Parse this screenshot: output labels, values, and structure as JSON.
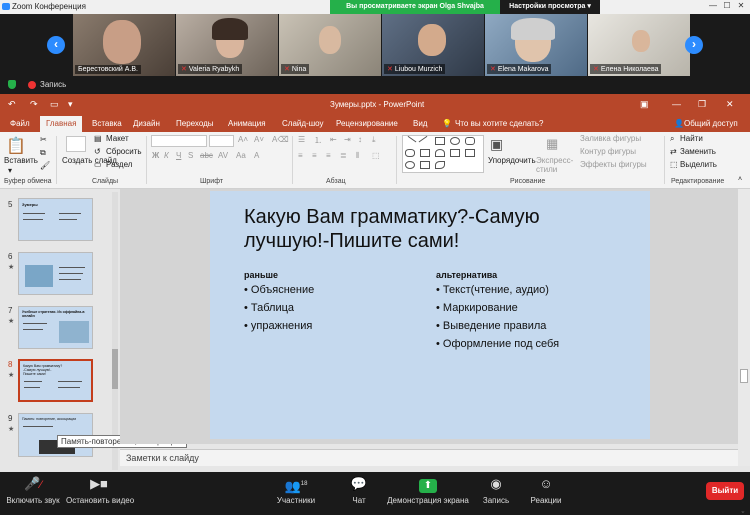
{
  "zoom": {
    "app_title": "Zoom Конференция",
    "share_banner": "Вы просматриваете экран Olga Shvajba",
    "view_settings": "Настройки просмотра",
    "recording_label": "Запись",
    "participants": [
      {
        "name": "Берестовский А.В.",
        "muted": false
      },
      {
        "name": "Valeria Ryabykh",
        "muted": true
      },
      {
        "name": "Nina",
        "muted": true
      },
      {
        "name": "Liubou Murzich",
        "muted": true
      },
      {
        "name": "Elena Makarova",
        "muted": true
      },
      {
        "name": "Елена Николаева",
        "muted": false
      }
    ],
    "toolbar": {
      "unmute": "Включить звук",
      "start_video": "Остановить видео",
      "participants": "Участники",
      "participants_count": "18",
      "chat": "Чат",
      "share_screen": "Демонстрация экрана",
      "record": "Запись",
      "reactions": "Реакции",
      "leave": "Выйти"
    }
  },
  "ppt": {
    "doc_title": "Зумеры.pptx - PowerPoint",
    "tabs": [
      "Файл",
      "Главная",
      "Вставка",
      "Дизайн",
      "Переходы",
      "Анимация",
      "Слайд-шоу",
      "Рецензирование",
      "Вид"
    ],
    "active_tab": "Главная",
    "tell_me": "Что вы хотите сделать?",
    "share": "Общий доступ",
    "ribbon": {
      "paste": "Вставить",
      "clipboard_group": "Буфер обмена",
      "new_slide": "Создать слайд",
      "layout": "Макет",
      "reset": "Сбросить",
      "section": "Раздел",
      "slides_group": "Слайды",
      "font_group": "Шрифт",
      "paragraph_group": "Абзац",
      "arrange": "Упорядочить",
      "express_styles": "Экспресс-стили",
      "shape_fill": "Заливка фигуры",
      "shape_outline": "Контур фигуры",
      "shape_effects": "Эффекты фигуры",
      "drawing_group": "Рисование",
      "find": "Найти",
      "replace": "Заменить",
      "select": "Выделить",
      "editing_group": "Редактирование"
    },
    "thumbnails": [
      {
        "num": "5",
        "title": "Зумеры"
      },
      {
        "num": "6",
        "title": ""
      },
      {
        "num": "7",
        "title": "Учебные стратегии. Из оффлайна-в онлайн"
      },
      {
        "num": "8",
        "title": "Какую Вам грамматику?-Самую лучшую!-Пишите сами!"
      },
      {
        "num": "9",
        "title": "Память: повторение, ассоциации"
      }
    ],
    "tooltip": "Память-повторение,ассоциаци...",
    "slide": {
      "title": "Какую Вам грамматику?-Самую лучшую!-Пишите сами!",
      "left_head": "раньше",
      "left_items": [
        "• Объяснение",
        "• Таблица",
        "• упражнения"
      ],
      "right_head": "альтернатива",
      "right_items": [
        "• Текст(чтение, аудио)",
        "• Маркирование",
        "• Выведение правила",
        "• Оформление под себя"
      ]
    },
    "notes_placeholder": "Заметки к слайду"
  },
  "colors": {
    "ppt_accent": "#b7472a",
    "zoom_green": "#25b04a",
    "zoom_blue": "#2d8cff",
    "leave_red": "#e02828",
    "slide_bg": "#c5d9ee"
  }
}
